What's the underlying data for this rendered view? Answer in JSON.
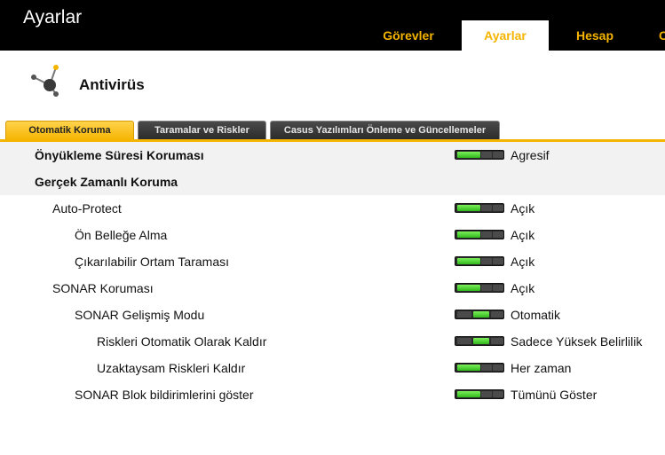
{
  "window": {
    "title": "Ayarlar"
  },
  "top_tabs": [
    {
      "label": "Görevler",
      "active": false
    },
    {
      "label": "Ayarlar",
      "active": true
    },
    {
      "label": "Hesap",
      "active": false
    },
    {
      "label": "C",
      "active": false
    }
  ],
  "section": {
    "title": "Antivirüs",
    "icon": "network-nodes-icon"
  },
  "sub_tabs": [
    {
      "label": "Otomatik Koruma",
      "active": true
    },
    {
      "label": "Taramalar ve Riskler",
      "active": false
    },
    {
      "label": "Casus Yazılımları Önleme ve Güncellemeler",
      "active": false
    }
  ],
  "settings": [
    {
      "label": "Önyükleme Süresi Koruması",
      "value": "Agresif",
      "level": 1,
      "state": "left"
    },
    {
      "label": "Gerçek Zamanlı Koruma",
      "value": "",
      "level": 1,
      "state": ""
    },
    {
      "label": "Auto-Protect",
      "value": "Açık",
      "level": 2,
      "state": "left"
    },
    {
      "label": "Ön Belleğe Alma",
      "value": "Açık",
      "level": 3,
      "state": "left"
    },
    {
      "label": "Çıkarılabilir Ortam Taraması",
      "value": "Açık",
      "level": 3,
      "state": "left"
    },
    {
      "label": "SONAR Koruması",
      "value": "Açık",
      "level": 2,
      "state": "left"
    },
    {
      "label": "SONAR Gelişmiş Modu",
      "value": "Otomatik",
      "level": 3,
      "state": "middle"
    },
    {
      "label": "Riskleri Otomatik Olarak Kaldır",
      "value": "Sadece Yüksek Belirlilik",
      "level": 4,
      "state": "middle"
    },
    {
      "label": "Uzaktaysam Riskleri Kaldır",
      "value": "Her zaman",
      "level": 4,
      "state": "left"
    },
    {
      "label": "SONAR Blok bildirimlerini göster",
      "value": "Tümünü Göster",
      "level": 3,
      "state": "left"
    }
  ],
  "colors": {
    "accent": "#f5b400",
    "toggle_on": "#3cc726",
    "titlebar": "#000000"
  }
}
